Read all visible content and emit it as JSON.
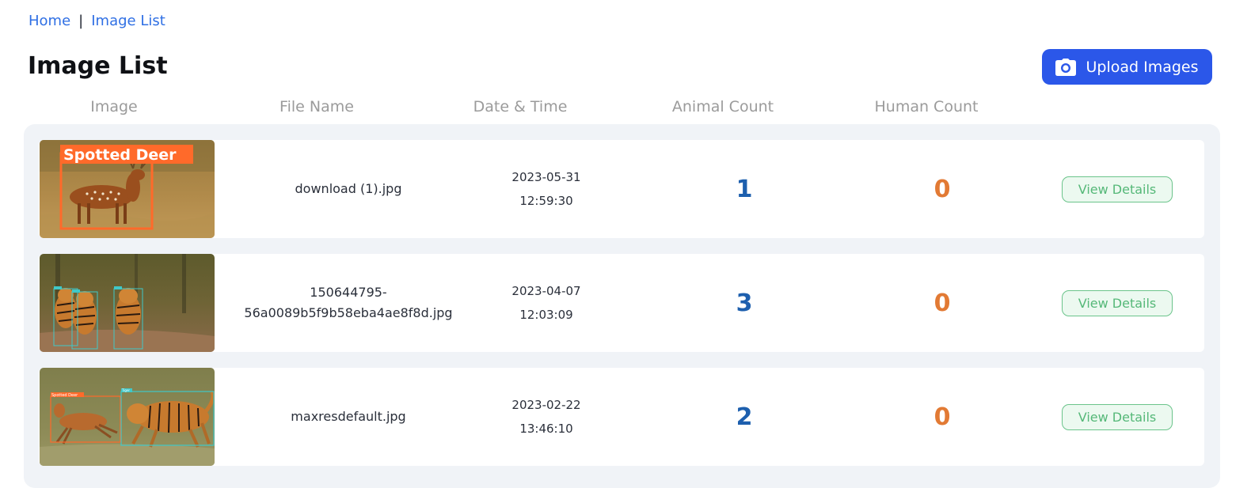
{
  "breadcrumb": {
    "home": "Home",
    "separator": "|",
    "current": "Image List"
  },
  "page_title": "Image List",
  "upload_button": {
    "label": "Upload Images",
    "icon": "camera-icon",
    "color": "#2b57e9"
  },
  "columns": {
    "image": "Image",
    "file_name": "File Name",
    "date_time": "Date & Time",
    "animal_count": "Animal Count",
    "human_count": "Human Count"
  },
  "rows": [
    {
      "thumbnail_label": "Spotted Deer",
      "file_name_lines": [
        "download (1).jpg"
      ],
      "date": "2023-05-31",
      "time": "12:59:30",
      "animal_count": "1",
      "human_count": "0",
      "action": "View Details"
    },
    {
      "thumbnail_label": "",
      "file_name_lines": [
        "150644795-",
        "56a0089b5f9b58eba4ae8f8d.jpg"
      ],
      "date": "2023-04-07",
      "time": "12:03:09",
      "animal_count": "3",
      "human_count": "0",
      "action": "View Details"
    },
    {
      "thumbnail_label": "Spotted Deer",
      "thumbnail_label_2": "Tiger",
      "file_name_lines": [
        "maxresdefault.jpg"
      ],
      "date": "2023-02-22",
      "time": "13:46:10",
      "animal_count": "2",
      "human_count": "0",
      "action": "View Details"
    }
  ],
  "colors": {
    "link": "#2f6fe4",
    "animal_count": "#1d5fae",
    "human_count": "#e27a34",
    "view_button": "#55b878",
    "panel_bg": "#f0f3f7"
  }
}
